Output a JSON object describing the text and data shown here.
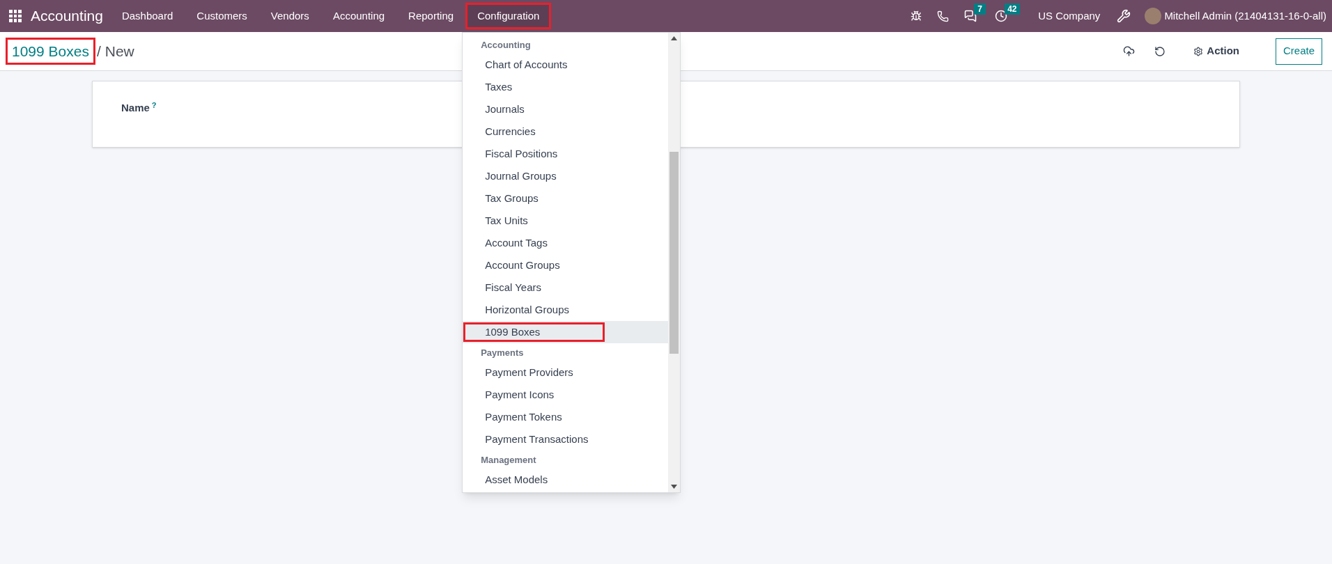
{
  "navbar": {
    "app_name": "Accounting",
    "menu": [
      {
        "label": "Dashboard",
        "selected": false,
        "highlighted": false
      },
      {
        "label": "Customers",
        "selected": false,
        "highlighted": false
      },
      {
        "label": "Vendors",
        "selected": false,
        "highlighted": false
      },
      {
        "label": "Accounting",
        "selected": false,
        "highlighted": false
      },
      {
        "label": "Reporting",
        "selected": false,
        "highlighted": false
      },
      {
        "label": "Configuration",
        "selected": true,
        "highlighted": true
      }
    ],
    "messages_badge": "7",
    "activities_badge": "42",
    "company": "US Company",
    "user": "Mitchell Admin (21404131-16-0-all)"
  },
  "breadcrumb": {
    "parent": "1099 Boxes",
    "parent_highlighted": true,
    "separator": "/",
    "current": "New"
  },
  "control_panel": {
    "action_label": "Action",
    "create_label": "Create"
  },
  "form": {
    "name_label": "Name",
    "help_mark": "?"
  },
  "dropdown": {
    "sections": [
      {
        "title": "Accounting",
        "items": [
          {
            "label": "Chart of Accounts",
            "selected": false,
            "highlighted": false
          },
          {
            "label": "Taxes",
            "selected": false,
            "highlighted": false
          },
          {
            "label": "Journals",
            "selected": false,
            "highlighted": false
          },
          {
            "label": "Currencies",
            "selected": false,
            "highlighted": false
          },
          {
            "label": "Fiscal Positions",
            "selected": false,
            "highlighted": false
          },
          {
            "label": "Journal Groups",
            "selected": false,
            "highlighted": false
          },
          {
            "label": "Tax Groups",
            "selected": false,
            "highlighted": false
          },
          {
            "label": "Tax Units",
            "selected": false,
            "highlighted": false
          },
          {
            "label": "Account Tags",
            "selected": false,
            "highlighted": false
          },
          {
            "label": "Account Groups",
            "selected": false,
            "highlighted": false
          },
          {
            "label": "Fiscal Years",
            "selected": false,
            "highlighted": false
          },
          {
            "label": "Horizontal Groups",
            "selected": false,
            "highlighted": false
          },
          {
            "label": "1099 Boxes",
            "selected": true,
            "highlighted": true
          }
        ]
      },
      {
        "title": "Payments",
        "items": [
          {
            "label": "Payment Providers",
            "selected": false,
            "highlighted": false
          },
          {
            "label": "Payment Icons",
            "selected": false,
            "highlighted": false
          },
          {
            "label": "Payment Tokens",
            "selected": false,
            "highlighted": false
          },
          {
            "label": "Payment Transactions",
            "selected": false,
            "highlighted": false
          }
        ]
      },
      {
        "title": "Management",
        "items": [
          {
            "label": "Asset Models",
            "selected": false,
            "highlighted": false
          }
        ]
      }
    ]
  }
}
